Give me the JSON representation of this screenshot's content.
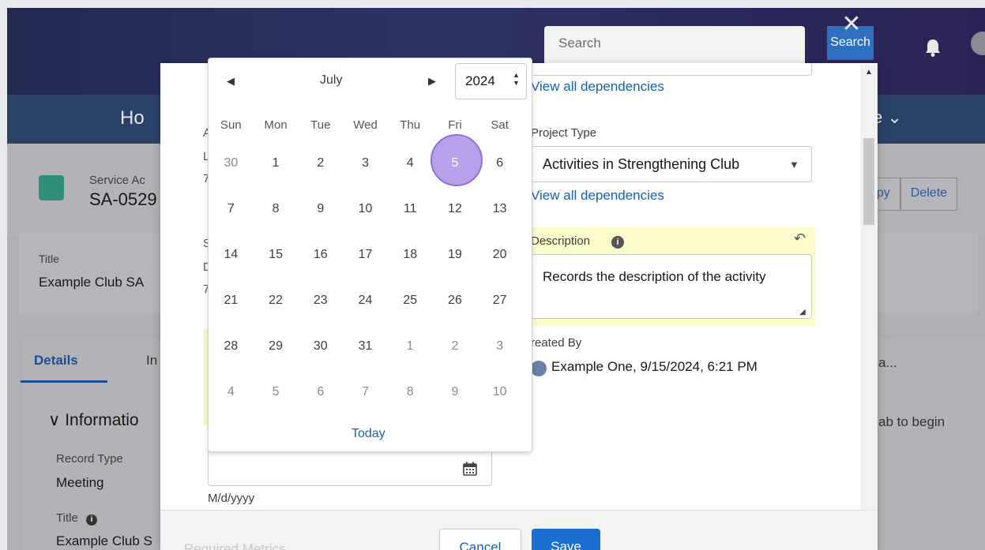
{
  "header": {
    "search_placeholder": "Search",
    "search_button": "Search",
    "close_glyph": "✕"
  },
  "nav": {
    "home_label": "Ho",
    "more_label": "e ⌄"
  },
  "record": {
    "object_label": "Service Ac",
    "name": "SA-0529",
    "actions": [
      "opy",
      "Delete"
    ]
  },
  "highlights": {
    "title_label": "Title",
    "title_value": "Example Club SA"
  },
  "tabs": {
    "details": "Details",
    "other": "In",
    "right_ghost1": "a...",
    "right_ghost2": "ab to begin"
  },
  "info_section": {
    "title": "Informatio",
    "record_type_label": "Record Type",
    "record_type_value": "Meeting",
    "title_label": "Title",
    "title_value": "Example Club S"
  },
  "modal": {
    "left_bits": [
      "A",
      "L",
      "7",
      "S",
      "D",
      "7"
    ],
    "view_all_dependencies_1": "View all dependencies",
    "project_type_label": "Project Type",
    "project_type_value": "Activities in Strengthening Club",
    "view_all_dependencies_2": "View all dependencies",
    "description_label": "Description",
    "description_value": "Records the description of the activity",
    "created_by_label": "reated By",
    "created_by_value": "Example One, 9/15/2024, 6:21 PM",
    "date_format": "M/d/yyyy",
    "cancel": "Cancel",
    "save": "Save",
    "footer_ghost": "Required Metrics"
  },
  "datepicker": {
    "month": "July",
    "year": "2024",
    "today": "Today",
    "selected_day": "5",
    "weekdays": [
      "Sun",
      "Mon",
      "Tue",
      "Wed",
      "Thu",
      "Fri",
      "Sat"
    ],
    "weeks": [
      [
        {
          "d": "30",
          "out": true
        },
        {
          "d": "1"
        },
        {
          "d": "2"
        },
        {
          "d": "3"
        },
        {
          "d": "4"
        },
        {
          "d": "5",
          "sel": true
        },
        {
          "d": "6"
        }
      ],
      [
        {
          "d": "7"
        },
        {
          "d": "8"
        },
        {
          "d": "9"
        },
        {
          "d": "10"
        },
        {
          "d": "11"
        },
        {
          "d": "12"
        },
        {
          "d": "13"
        }
      ],
      [
        {
          "d": "14"
        },
        {
          "d": "15"
        },
        {
          "d": "16"
        },
        {
          "d": "17"
        },
        {
          "d": "18"
        },
        {
          "d": "19"
        },
        {
          "d": "20"
        }
      ],
      [
        {
          "d": "21"
        },
        {
          "d": "22"
        },
        {
          "d": "23"
        },
        {
          "d": "24"
        },
        {
          "d": "25"
        },
        {
          "d": "26"
        },
        {
          "d": "27"
        }
      ],
      [
        {
          "d": "28"
        },
        {
          "d": "29"
        },
        {
          "d": "30"
        },
        {
          "d": "31"
        },
        {
          "d": "1",
          "out": true
        },
        {
          "d": "2",
          "out": true
        },
        {
          "d": "3",
          "out": true
        }
      ],
      [
        {
          "d": "4",
          "out": true
        },
        {
          "d": "5",
          "out": true
        },
        {
          "d": "6",
          "out": true
        },
        {
          "d": "7",
          "out": true
        },
        {
          "d": "8",
          "out": true
        },
        {
          "d": "9",
          "out": true
        },
        {
          "d": "10",
          "out": true
        }
      ]
    ]
  },
  "colors": {
    "brand_blue": "#1a6fcf",
    "link_blue": "#1b5fae",
    "highlight_yellow": "#fbfbcc",
    "selected_day": "#b8a1ea"
  }
}
